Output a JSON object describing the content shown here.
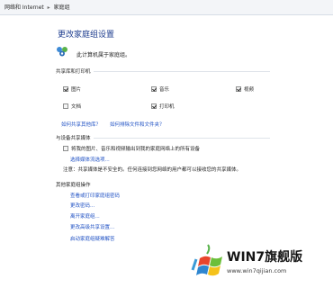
{
  "breadcrumb": {
    "items": [
      "网络和 Internet",
      "家庭组"
    ]
  },
  "page": {
    "title": "更改家庭组设置",
    "joined_text": "此计算机属于家庭组。"
  },
  "sharing": {
    "heading": "共享库和打印机",
    "items": [
      {
        "label": "图片",
        "checked": true
      },
      {
        "label": "音乐",
        "checked": true
      },
      {
        "label": "视频",
        "checked": true
      },
      {
        "label": "文档",
        "checked": false
      },
      {
        "label": "打印机",
        "checked": true
      }
    ],
    "link_share_files": "如何共享其他库？",
    "link_exclude": "如何排除文件和文件夹？"
  },
  "media": {
    "heading": "与设备共享媒体",
    "stream_label": "将我的图片、音乐和视频输出到我的家庭网络上的所有设备",
    "stream_checked": false,
    "stream_options_link": "选择媒体流选项...",
    "note": "注意：共享媒体是不安全的。任何连接到您网络的用户都可以接收您的共享媒体。"
  },
  "other_actions": {
    "heading": "其他家庭组操作",
    "links": [
      "查看或打印家庭组密码",
      "更改密码...",
      "离开家庭组...",
      "更改高级共享设置...",
      "启动家庭组疑难解答"
    ]
  },
  "watermark": {
    "brand": "WIN7旗舰版",
    "url": "www.win7qijian.com"
  },
  "colors": {
    "link": "#1f51c4",
    "title": "#1e3d8f"
  }
}
